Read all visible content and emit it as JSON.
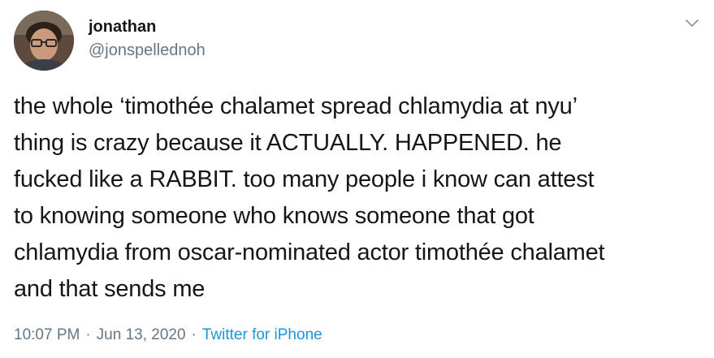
{
  "user": {
    "display_name": "jonathan",
    "handle": "@jonspellednoh"
  },
  "tweet": {
    "text": "the whole ‘timothée chalamet spread chlamydia at nyu’\nthing is crazy because it ACTUALLY. HAPPENED. he\nfucked like a RABBIT. too many people i know can attest\nto knowing someone who knows someone that got\nchlamydia from oscar-nominated actor timothée chalamet\nand that sends me",
    "time": "10:07 PM",
    "date": "Jun 13, 2020",
    "separator": "·",
    "source": "Twitter for iPhone"
  },
  "icons": {
    "menu": "chevron-down-icon"
  },
  "colors": {
    "text": "#14171a",
    "secondary": "#657786",
    "link": "#1b95e0",
    "background": "#ffffff"
  }
}
